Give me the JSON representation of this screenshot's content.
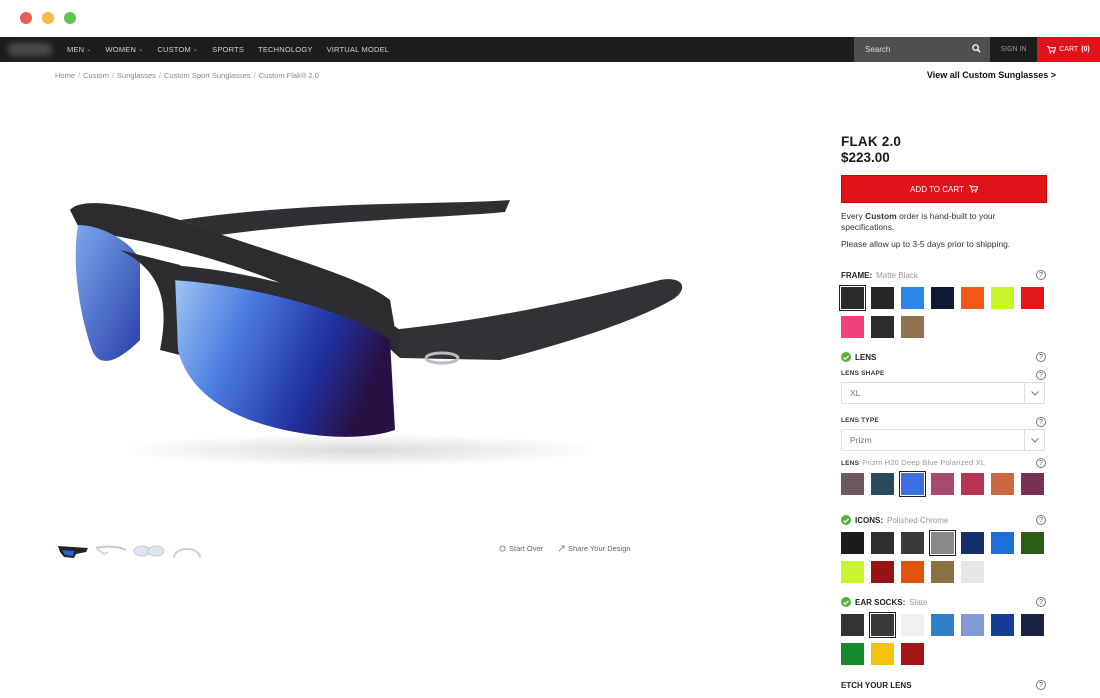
{
  "nav": {
    "menu": [
      {
        "label": "MEN",
        "dropdown": true
      },
      {
        "label": "WOMEN",
        "dropdown": true
      },
      {
        "label": "CUSTOM",
        "dropdown": true
      },
      {
        "label": "SPORTS",
        "dropdown": false
      },
      {
        "label": "TECHNOLOGY",
        "dropdown": false
      },
      {
        "label": "VIRTUAL MODEL",
        "dropdown": false
      }
    ],
    "search_placeholder": "Search",
    "signin": "SIGN IN",
    "cart_label": "CART",
    "cart_count": "(0)"
  },
  "breadcrumb": [
    "Home",
    "Custom",
    "Sunglasses",
    "Custom Sport Sunglasses",
    "Custom Flak® 2.0"
  ],
  "view_all": "View all Custom Sunglasses >",
  "actions": {
    "start_over": "Start Over",
    "share": "Share Your Design"
  },
  "product": {
    "name": "FLAK 2.0",
    "price": "$223.00",
    "add_to_cart": "ADD TO CART",
    "note_prefix": "Every ",
    "note_bold": "Custom",
    "note_suffix": " order is hand-built to your specifications.",
    "note2": "Please allow up to 3-5 days prior to shipping."
  },
  "frame": {
    "label": "FRAME:",
    "value": "Matte Black",
    "swatches": [
      "#2b2b2d",
      "#262626",
      "#2f86e8",
      "#111a33",
      "#f05a16",
      "#c8f529",
      "#e0191b",
      "#f2407a",
      "#2c2c2c",
      "#8f7352"
    ]
  },
  "lens": {
    "label": "LENS",
    "shape_label": "LENS SHAPE",
    "shape_value": "XL",
    "type_label": "LENS TYPE",
    "type_value": "Prizm",
    "lens_label": "LENS",
    "lens_value": "Prizm H20 Deep Blue Polarized XL",
    "swatches": [
      "#6d5860",
      "#2b4a5e",
      "#3d6fe0",
      "#a84a6e",
      "#b83352",
      "#c9673e",
      "#7a2f55"
    ]
  },
  "icons": {
    "label": "ICONS:",
    "value": "Polished Chrome",
    "swatches": [
      "#1c1c1c",
      "#2f2f2f",
      "#3a3a3a",
      "#8a8a8a",
      "#13306b",
      "#1b6fd6",
      "#2b5e14",
      "#c7f531",
      "#9b1212",
      "#e2530f",
      "#8a7040",
      "#e6e6e6"
    ]
  },
  "ear_socks": {
    "label": "EAR SOCKS:",
    "value": "Slate",
    "swatches": [
      "#333333",
      "#3a3a3a",
      "#f0f0f0",
      "#2f7fc9",
      "#7f9bd3",
      "#153d92",
      "#1a2245",
      "#138a2c",
      "#f2c20f",
      "#a51515"
    ]
  },
  "etch": {
    "label": "ETCH YOUR LENS"
  }
}
